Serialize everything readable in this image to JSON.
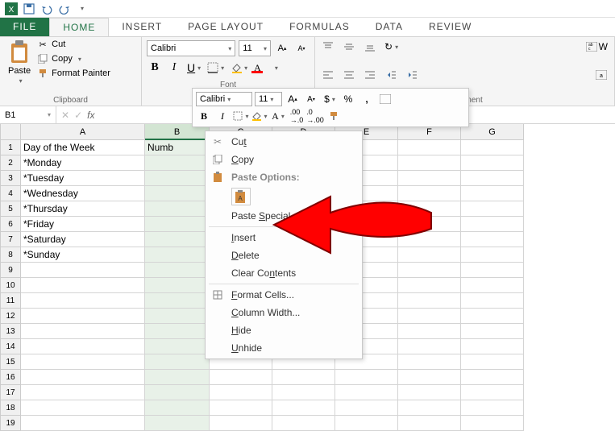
{
  "app_name": "Excel",
  "qat": {
    "save": "Save",
    "undo": "Undo",
    "redo": "Redo"
  },
  "tabs": [
    "FILE",
    "HOME",
    "INSERT",
    "PAGE LAYOUT",
    "FORMULAS",
    "DATA",
    "REVIEW"
  ],
  "active_tab": "HOME",
  "ribbon": {
    "clipboard": {
      "paste": "Paste",
      "cut": "Cut",
      "copy": "Copy",
      "format_painter": "Format Painter",
      "label": "Clipboard"
    },
    "font": {
      "name": "Calibri",
      "size": "11",
      "label": "Font"
    },
    "alignment": {
      "wrap": "W",
      "label": "Alignment"
    }
  },
  "name_box": "B1",
  "mini_toolbar": {
    "font": "Calibri",
    "size": "11"
  },
  "context_menu": {
    "cut": "Cut",
    "copy": "Copy",
    "paste_options": "Paste Options:",
    "paste_special": "Paste Special...",
    "insert": "Insert",
    "delete": "Delete",
    "clear": "Clear Contents",
    "format_cells": "Format Cells...",
    "column_width": "Column Width...",
    "hide": "Hide",
    "unhide": "Unhide"
  },
  "columns": [
    {
      "id": "A",
      "w": 154
    },
    {
      "id": "B",
      "w": 80,
      "selected": true
    },
    {
      "id": "C",
      "w": 78
    },
    {
      "id": "D",
      "w": 78
    },
    {
      "id": "E",
      "w": 78
    },
    {
      "id": "F",
      "w": 78
    },
    {
      "id": "G",
      "w": 78
    }
  ],
  "rows": [
    {
      "n": 1,
      "A": "Day of the Week",
      "B": "Numb"
    },
    {
      "n": 2,
      "A": "*Monday"
    },
    {
      "n": 3,
      "A": "*Tuesday"
    },
    {
      "n": 4,
      "A": "*Wednesday"
    },
    {
      "n": 5,
      "A": "*Thursday"
    },
    {
      "n": 6,
      "A": "*Friday"
    },
    {
      "n": 7,
      "A": "*Saturday"
    },
    {
      "n": 8,
      "A": "*Sunday"
    },
    {
      "n": 9
    },
    {
      "n": 10
    },
    {
      "n": 11
    },
    {
      "n": 12
    },
    {
      "n": 13
    },
    {
      "n": 14
    },
    {
      "n": 15
    },
    {
      "n": 16
    },
    {
      "n": 17
    },
    {
      "n": 18
    },
    {
      "n": 19
    }
  ],
  "colors": {
    "accent": "#217346",
    "arrow": "#ff0000"
  }
}
